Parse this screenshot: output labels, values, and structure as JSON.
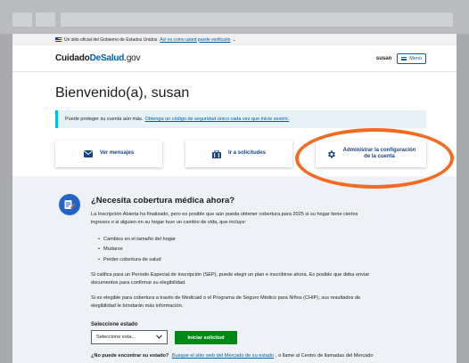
{
  "gov_banner": {
    "text": "Un sitio oficial del Gobierno de Estados Unidos",
    "link": "Así es como usted puede verificarlo"
  },
  "header": {
    "logo_part1": "Cuidado",
    "logo_part2": "DeSalud",
    "logo_part3": ".gov",
    "user": "susan",
    "menu_label": "Menú"
  },
  "welcome": "Bienvenido(a), susan",
  "info": {
    "text": "Puede proteger su cuenta aún más.",
    "link": "Obtenga un código de seguridad único cada vez que inicie sesión."
  },
  "cards": {
    "messages": "Ver mensajes",
    "applications": "Ir a solicitudes",
    "settings_line1": "Administrar la configuración",
    "settings_line2": "de la cuenta"
  },
  "coverage": {
    "title": "¿Necesita cobertura médica ahora?",
    "intro_line1": "La Inscripción Abierta ha finalizado, pero es posible que aún pueda obtener cobertura para 2025 si su hogar tiene ciertos",
    "intro_line2": "ingresos o si alguien en su hogar tuvo un cambio de vida, que incluye:",
    "bullets": [
      "Cambios en el tamaño del hogar",
      "Mudarse",
      "Perder cobertura de salud"
    ],
    "sep_line1": "Si califica para un Período Especial de Inscripción (SEP), puede elegir un plan e inscribirse ahora. Es posible que deba enviar",
    "sep_line2": "documentos para confirmar su elegibilidad.",
    "chip_line1": "Si es elegible para cobertura a través de Medicaid o el Programa de Seguro Médico para Niños (CHIP), sus resultados de",
    "chip_line2": "elegibilidad le brindarán más información.",
    "state_label": "Seleccione estado",
    "state_value": "Seleccione esta...",
    "start_button": "Iniciar solicitud",
    "bottom_bold": "¿No puede encontrar su estado?",
    "bottom_link": "Busque el sitio web del Mercado de su estado",
    "bottom_rest": ", o llame al Centro de llamadas del Mercado"
  },
  "colors": {
    "accent": "#005ea2",
    "highlight": "#f26b21",
    "start_button": "#008817"
  }
}
